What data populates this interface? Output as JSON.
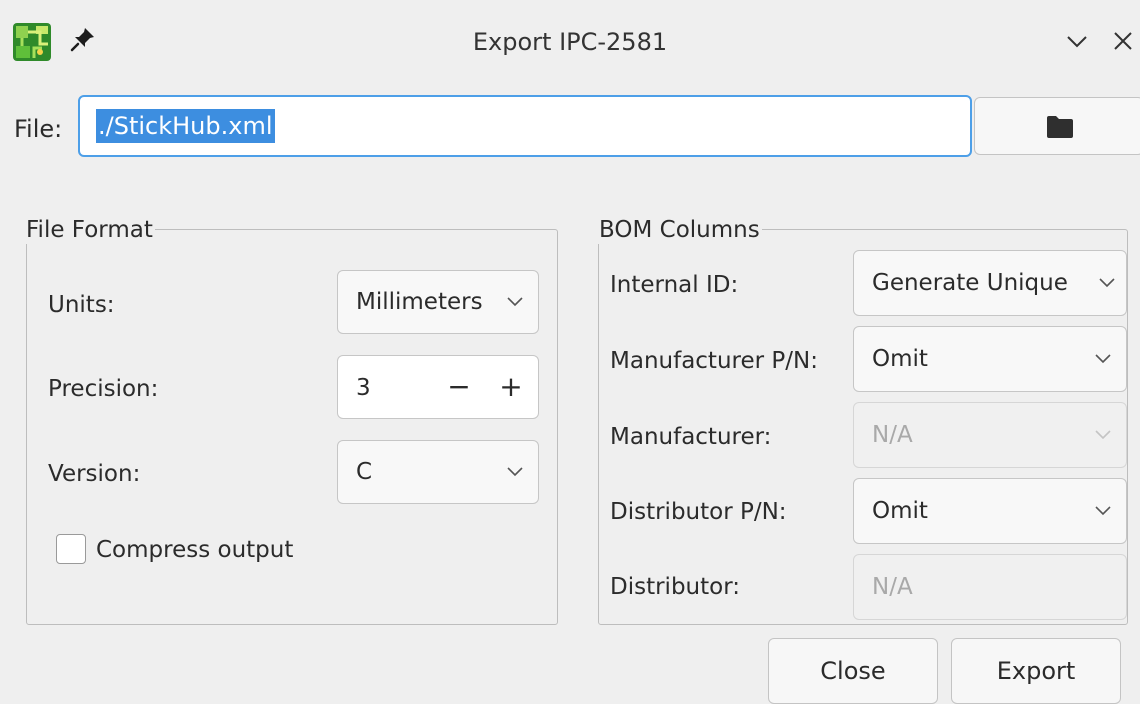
{
  "window": {
    "title": "Export IPC-2581"
  },
  "file": {
    "label": "File:",
    "value": "./StickHub.xml"
  },
  "file_format": {
    "title": "File Format",
    "units_label": "Units:",
    "units_value": "Millimeters",
    "precision_label": "Precision:",
    "precision_value": "3",
    "precision_minus": "−",
    "precision_plus": "+",
    "version_label": "Version:",
    "version_value": "C",
    "compress_label": "Compress output",
    "compress_checked": false
  },
  "bom_columns": {
    "title": "BOM Columns",
    "internal_id_label": "Internal ID:",
    "internal_id_value": "Generate Unique",
    "mfr_pn_label": "Manufacturer P/N:",
    "mfr_pn_value": "Omit",
    "mfr_label": "Manufacturer:",
    "mfr_value": "N/A",
    "dist_pn_label": "Distributor P/N:",
    "dist_pn_value": "Omit",
    "dist_label": "Distributor:",
    "dist_value": "N/A"
  },
  "buttons": {
    "close": "Close",
    "export": "Export"
  },
  "icons": {
    "app": "kicad-pcb-icon",
    "pin": "pin-icon",
    "minimize": "chevron-down-icon",
    "close": "close-icon",
    "browse": "folder-icon"
  },
  "colors": {
    "accent": "#3d8ee0",
    "background": "#efefef"
  }
}
